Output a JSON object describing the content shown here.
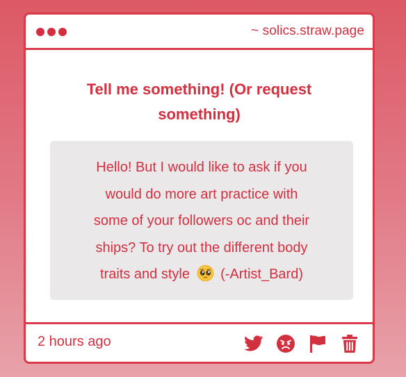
{
  "window": {
    "url": "~ solics.straw.page"
  },
  "prompt": {
    "line1": "Tell me something!  (Or request",
    "line2": "something)"
  },
  "message": {
    "line1": "Hello! But I would like to ask if you",
    "line2": "would do more art practice with",
    "line3": "some of your followers oc and their",
    "line4": "ships? To try out the different body",
    "line5_before_emoji": "traits and style",
    "line5_after_emoji": "(-Artist_Bard)",
    "emoji": "pleading-face-emoji"
  },
  "footer": {
    "timestamp": "2 hours ago",
    "actions": [
      {
        "icon": "twitter-icon"
      },
      {
        "icon": "angry-face-icon"
      },
      {
        "icon": "flag-icon"
      },
      {
        "icon": "trash-icon"
      }
    ]
  },
  "colors": {
    "accent": "#d22f3f",
    "message_bg": "#ebe8ea",
    "background_top": "#dc5965",
    "background_bottom": "#e8a2aa"
  }
}
